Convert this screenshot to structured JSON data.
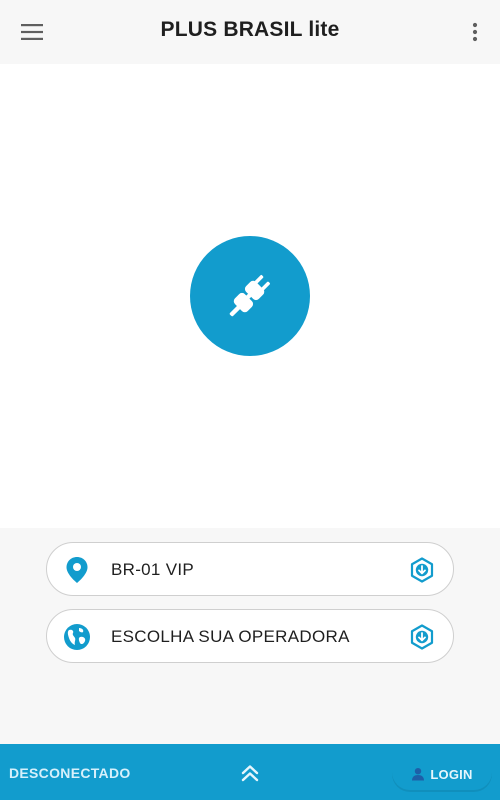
{
  "app": {
    "title": "PLUS BRASIL lite",
    "accent_color": "#129ccd"
  },
  "header": {
    "menu_icon": "hamburger-menu-icon",
    "more_icon": "more-vertical-icon"
  },
  "main": {
    "connect_icon": "plug-disconnected-icon",
    "connect_state": "disconnected"
  },
  "selectors": [
    {
      "label": "BR-01 VIP",
      "icon": "location-pin-icon",
      "action_icon": "download-icon"
    },
    {
      "label": "ESCOLHA SUA OPERADORA",
      "icon": "globe-icon",
      "action_icon": "download-icon"
    }
  ],
  "bottom_bar": {
    "status": "DESCONECTADO",
    "expand_icon": "double-chevron-up-icon",
    "login_label": "LOGIN",
    "login_icon": "user-icon"
  }
}
